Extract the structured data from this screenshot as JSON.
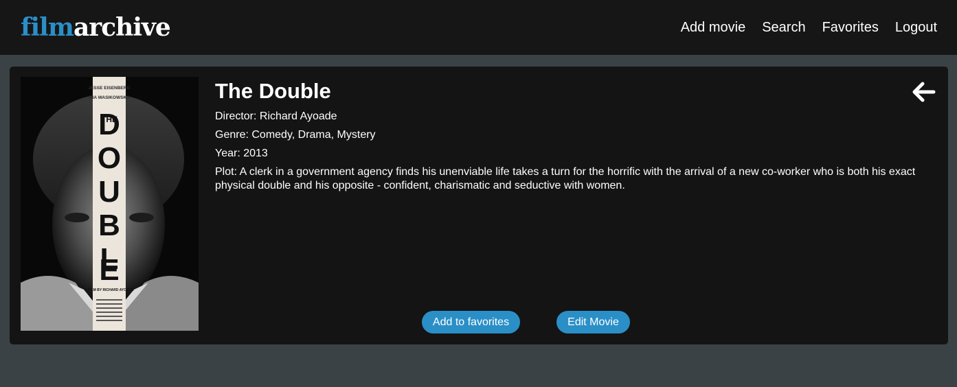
{
  "navbar": {
    "logo_part1": "film",
    "logo_part2": "archive",
    "links": [
      "Add movie",
      "Search",
      "Favorites",
      "Logout"
    ]
  },
  "movie": {
    "title": "The Double",
    "director": "Director: Richard Ayoade",
    "genre": "Genre: Comedy, Drama, Mystery",
    "year": "Year: 2013",
    "plot": "Plot: A clerk in a government agency finds his unenviable life takes a turn for the horrific with the arrival of a new co-worker who is both his exact physical double and his opposite - confident, charismatic and seductive with women.",
    "poster": {
      "cast_1": "JESSE EISENBERG",
      "cast_2": "MIA WASIKOWSKA",
      "the": "THE",
      "letters": [
        "D",
        "O",
        "U",
        "B",
        "L",
        "E"
      ],
      "credit": "A FILM BY RICHARD AYOADE"
    }
  },
  "actions": {
    "favorite_label": "Add to favorites",
    "edit_label": "Edit Movie"
  },
  "icons": {
    "back": "arrow-left-icon"
  },
  "colors": {
    "accent": "#2b8fc7",
    "navbar_bg": "#161616",
    "page_bg": "#3b4246",
    "card_bg": "#141414"
  }
}
